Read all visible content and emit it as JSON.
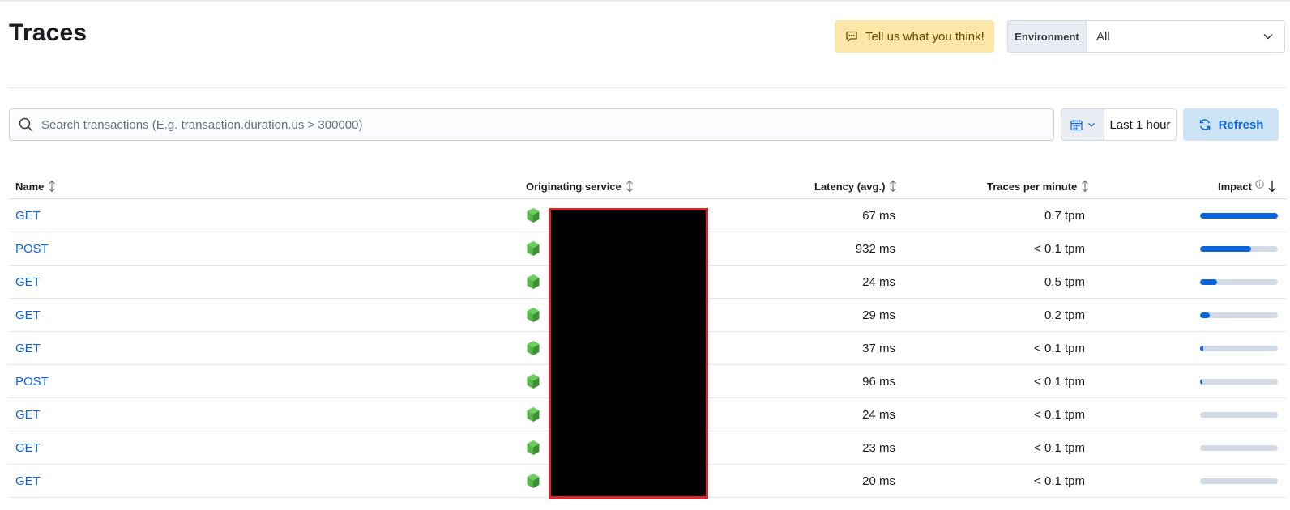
{
  "page": {
    "title": "Traces"
  },
  "feedback": {
    "label": "Tell us what you think!"
  },
  "environment": {
    "label": "Environment",
    "value": "All"
  },
  "search": {
    "placeholder": "Search transactions (E.g. transaction.duration.us > 300000)"
  },
  "date_picker": {
    "range_label": "Last 1 hour"
  },
  "refresh": {
    "label": "Refresh"
  },
  "table": {
    "columns": {
      "name": "Name",
      "service": "Originating service",
      "latency": "Latency (avg.)",
      "tpm": "Traces per minute",
      "impact": "Impact"
    },
    "rows": [
      {
        "name": "GET",
        "latency": "67 ms",
        "tpm": "0.7 tpm",
        "impact": 1.0
      },
      {
        "name": "POST",
        "latency": "932 ms",
        "tpm": "< 0.1 tpm",
        "impact": 0.66
      },
      {
        "name": "GET",
        "latency": "24 ms",
        "tpm": "0.5 tpm",
        "impact": 0.22
      },
      {
        "name": "GET",
        "latency": "29 ms",
        "tpm": "0.2 tpm",
        "impact": 0.12
      },
      {
        "name": "GET",
        "latency": "37 ms",
        "tpm": "< 0.1 tpm",
        "impact": 0.04
      },
      {
        "name": "POST",
        "latency": "96 ms",
        "tpm": "< 0.1 tpm",
        "impact": 0.02
      },
      {
        "name": "GET",
        "latency": "24 ms",
        "tpm": "< 0.1 tpm",
        "impact": 0.0
      },
      {
        "name": "GET",
        "latency": "23 ms",
        "tpm": "< 0.1 tpm",
        "impact": 0.0
      },
      {
        "name": "GET",
        "latency": "20 ms",
        "tpm": "< 0.1 tpm",
        "impact": 0.0
      }
    ]
  },
  "colors": {
    "accent": "#0b64dd",
    "agent_icon": "#54b748",
    "redaction_border": "#e0262a"
  },
  "icons": {
    "service_agent": "nodejs-icon",
    "sort": "sort-icon",
    "sort_desc": "arrow-down-icon",
    "info": "info-icon"
  }
}
